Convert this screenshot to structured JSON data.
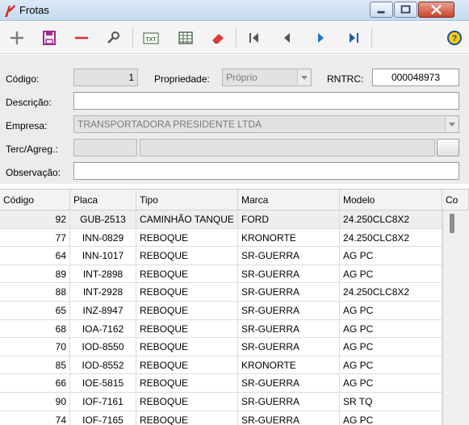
{
  "window": {
    "title": "Frotas"
  },
  "toolbar": {
    "icons": [
      "plus-icon",
      "save-icon",
      "minus-icon",
      "search-icon",
      "txt-export-icon",
      "table-icon",
      "eraser-icon",
      "first-record-icon",
      "prev-record-icon",
      "next-record-icon",
      "last-record-icon",
      "help-icon"
    ]
  },
  "form": {
    "codigo_label": "Código:",
    "codigo_value": "1",
    "propriedade_label": "Propriedade:",
    "propriedade_value": "Próprio",
    "rntrc_label": "RNTRC:",
    "rntrc_value": "000048973",
    "descricao_label": "Descrição:",
    "descricao_value": "",
    "empresa_label": "Empresa:",
    "empresa_value": "TRANSPORTADORA PRESIDENTE LTDA",
    "terc_label": "Terc/Agreg.:",
    "terc_code": "",
    "terc_name": "",
    "observacao_label": "Observação:",
    "observacao_value": ""
  },
  "grid": {
    "columns": [
      "Código",
      "Placa",
      "Tipo",
      "Marca",
      "Modelo",
      "Co"
    ],
    "rows": [
      {
        "codigo": "92",
        "placa": "GUB-2513",
        "tipo": "CAMINHÃO TANQUE",
        "marca": "FORD",
        "modelo": "24.250CLC8X2"
      },
      {
        "codigo": "77",
        "placa": "INN-0829",
        "tipo": "REBOQUE",
        "marca": "KRONORTE",
        "modelo": "24.250CLC8X2"
      },
      {
        "codigo": "64",
        "placa": "INN-1017",
        "tipo": "REBOQUE",
        "marca": "SR-GUERRA",
        "modelo": "AG PC"
      },
      {
        "codigo": "89",
        "placa": "INT-2898",
        "tipo": "REBOQUE",
        "marca": "SR-GUERRA",
        "modelo": "AG PC"
      },
      {
        "codigo": "88",
        "placa": "INT-2928",
        "tipo": "REBOQUE",
        "marca": "SR-GUERRA",
        "modelo": "24.250CLC8X2"
      },
      {
        "codigo": "65",
        "placa": "INZ-8947",
        "tipo": "REBOQUE",
        "marca": "SR-GUERRA",
        "modelo": "AG PC"
      },
      {
        "codigo": "68",
        "placa": "IOA-7162",
        "tipo": "REBOQUE",
        "marca": "SR-GUERRA",
        "modelo": "AG PC"
      },
      {
        "codigo": "70",
        "placa": "IOD-8550",
        "tipo": "REBOQUE",
        "marca": "SR-GUERRA",
        "modelo": "AG PC"
      },
      {
        "codigo": "85",
        "placa": "IOD-8552",
        "tipo": "REBOQUE",
        "marca": "KRONORTE",
        "modelo": "AG PC"
      },
      {
        "codigo": "66",
        "placa": "IOE-5815",
        "tipo": "REBOQUE",
        "marca": "SR-GUERRA",
        "modelo": "AG PC"
      },
      {
        "codigo": "90",
        "placa": "IOF-7161",
        "tipo": "REBOQUE",
        "marca": "SR-GUERRA",
        "modelo": "SR TQ"
      },
      {
        "codigo": "74",
        "placa": "IOF-7165",
        "tipo": "REBOQUE",
        "marca": "SR-GUERRA",
        "modelo": "AG PC"
      }
    ]
  }
}
